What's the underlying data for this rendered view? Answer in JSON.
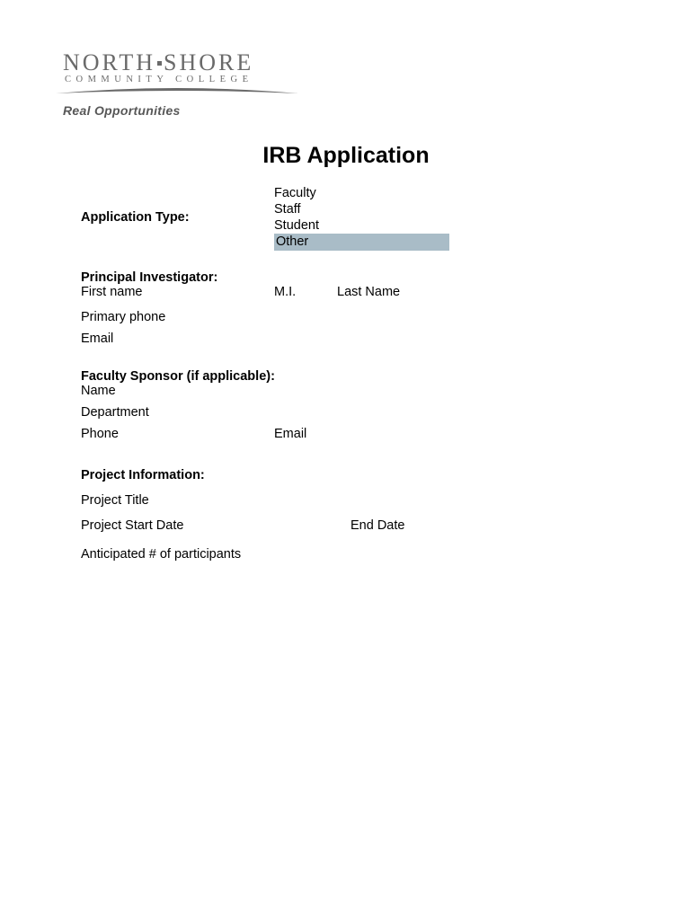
{
  "logo": {
    "line1a": "NORTH",
    "line1b": "SHORE",
    "line2": "COMMUNITY COLLEGE",
    "tagline": "Real Opportunities"
  },
  "title": "IRB Application",
  "appType": {
    "label": "Application Type:",
    "options": [
      "Faculty",
      "Staff",
      "Student",
      "Other"
    ]
  },
  "pi": {
    "heading": "Principal Investigator:",
    "firstName": "First name",
    "mi": "M.I.",
    "lastName": "Last Name",
    "primaryPhone": "Primary phone",
    "email": "Email"
  },
  "sponsor": {
    "heading": "Faculty Sponsor (if applicable):",
    "name": "Name",
    "department": "Department",
    "phone": "Phone",
    "email": "Email"
  },
  "project": {
    "heading": "Project Information:",
    "title": "Project Title",
    "startDate": "Project Start Date",
    "endDate": "End Date",
    "participants": "Anticipated # of participants"
  }
}
